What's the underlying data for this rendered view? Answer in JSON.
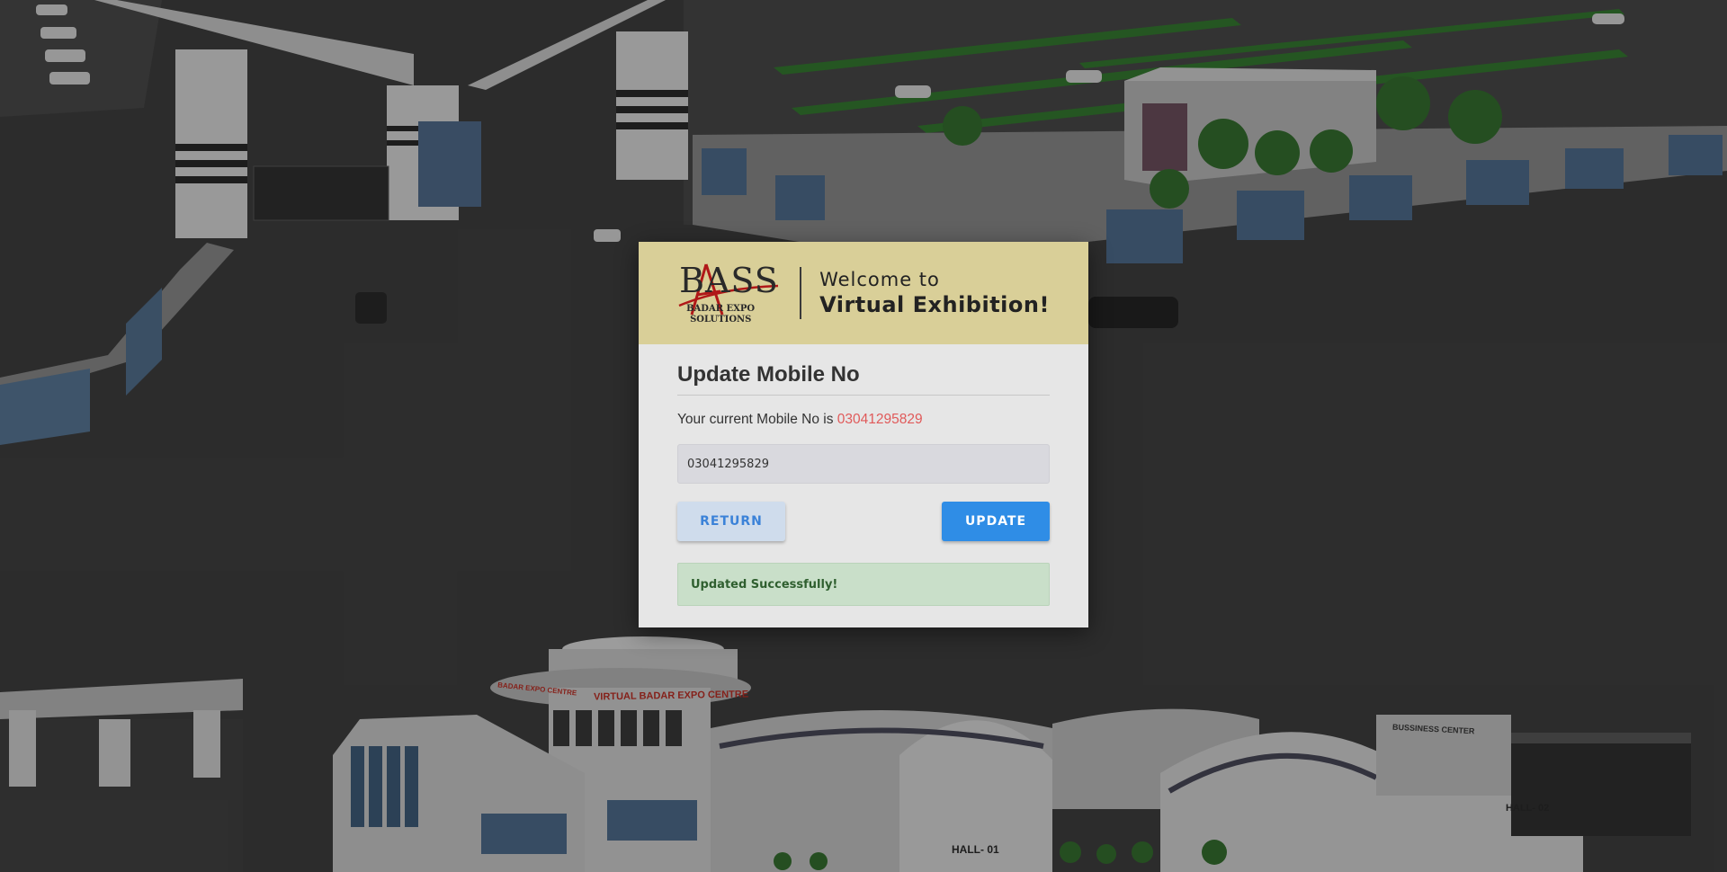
{
  "header": {
    "logo_text": "BASS",
    "logo_subtitle_1": "BADAR EXPO",
    "logo_subtitle_2": "SOLUTIONS",
    "welcome_line1": "Welcome to",
    "welcome_line2": "Virtual Exhibition!"
  },
  "form": {
    "title": "Update Mobile No",
    "current_label": "Your current Mobile No is",
    "current_number": "03041295829",
    "input_value": "03041295829",
    "return_label": "RETURN",
    "update_label": "UPDATE",
    "success_message": "Updated Successfully!"
  },
  "scene_labels": {
    "centre_sign": "VIRTUAL BADAR EXPO CENTRE",
    "centre_sign_left": "BADAR EXPO CENTRE",
    "business_center": "BUSSINESS CENTER",
    "hall_1": "HALL- 01",
    "hall_2": "HALL- 02"
  },
  "colors": {
    "header_bg": "#d9cf98",
    "accent_blue": "#2f8de6",
    "number_red": "#e05a5a",
    "success_bg": "#c9dfc9"
  }
}
